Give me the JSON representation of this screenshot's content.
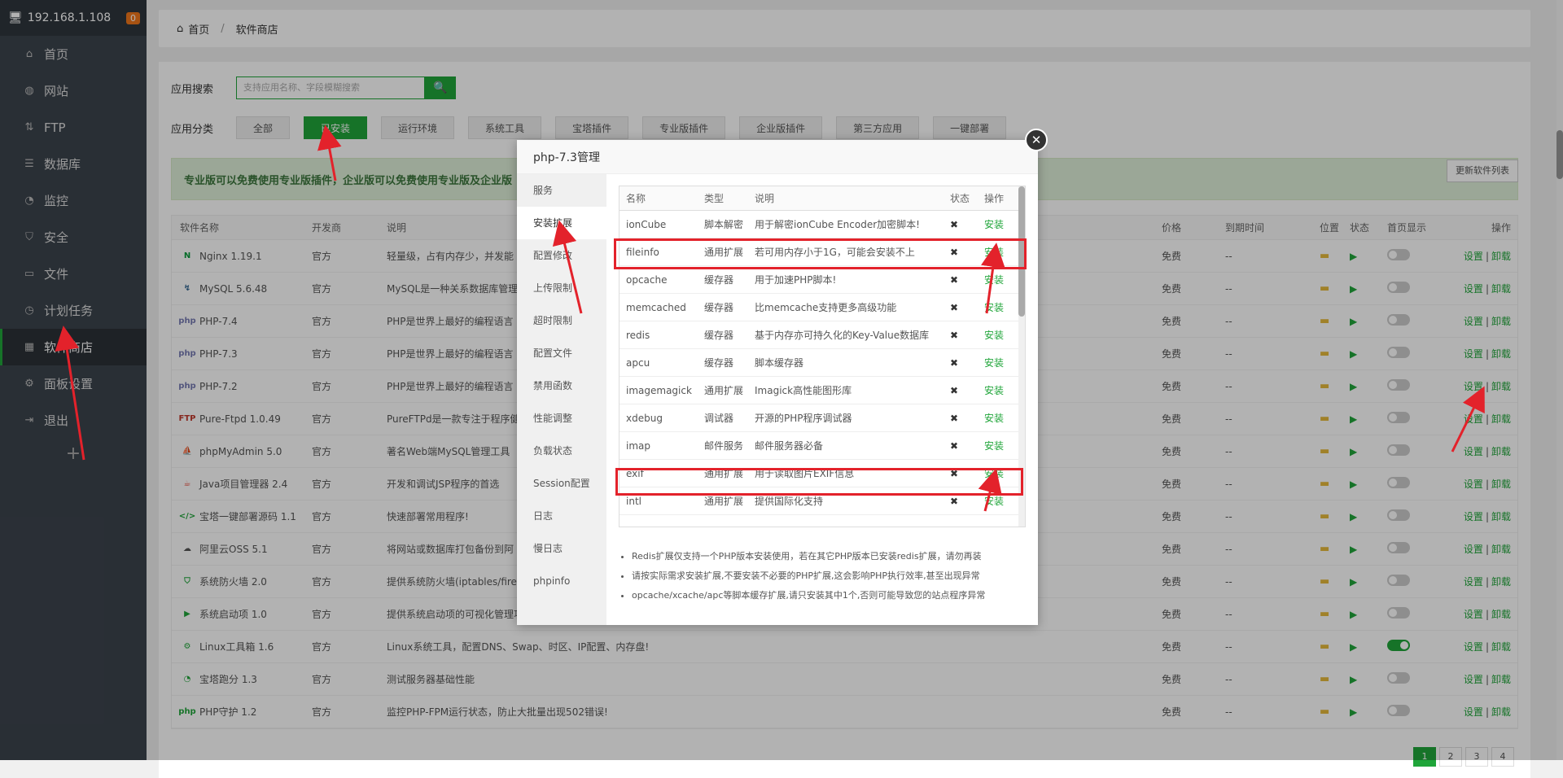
{
  "sidebar": {
    "host": "192.168.1.108",
    "badge": "0",
    "items": [
      {
        "label": "首页",
        "icon": "home-icon",
        "glyph": "⌂"
      },
      {
        "label": "网站",
        "icon": "globe-icon",
        "glyph": "◍"
      },
      {
        "label": "FTP",
        "icon": "ftp-icon",
        "glyph": "⇅"
      },
      {
        "label": "数据库",
        "icon": "database-icon",
        "glyph": "☰"
      },
      {
        "label": "监控",
        "icon": "monitor-icon",
        "glyph": "◔"
      },
      {
        "label": "安全",
        "icon": "shield-icon",
        "glyph": "⛉"
      },
      {
        "label": "文件",
        "icon": "file-icon",
        "glyph": "▭"
      },
      {
        "label": "计划任务",
        "icon": "clock-icon",
        "glyph": "◷"
      },
      {
        "label": "软件商店",
        "icon": "apps-icon",
        "glyph": "▦"
      },
      {
        "label": "面板设置",
        "icon": "gear-icon",
        "glyph": "⚙"
      },
      {
        "label": "退出",
        "icon": "logout-icon",
        "glyph": "⇥"
      }
    ],
    "active_index": 8,
    "add": "+"
  },
  "breadcrumb": {
    "home": "首页",
    "sep": "/",
    "current": "软件商店"
  },
  "search": {
    "label": "应用搜索",
    "placeholder": "支持应用名称、字段模糊搜索",
    "button": "🔍"
  },
  "categories": {
    "label": "应用分类",
    "items": [
      "全部",
      "已安装",
      "运行环境",
      "系统工具",
      "宝塔插件",
      "专业版插件",
      "企业版插件",
      "第三方应用",
      "一键部署"
    ],
    "active_index": 1,
    "refresh": "更新软件列表"
  },
  "notice": "专业版可以免费使用专业版插件，企业版可以免费使用专业版及企业版",
  "table": {
    "headers": {
      "name": "软件名称",
      "dev": "开发商",
      "desc": "说明",
      "price": "价格",
      "expire": "到期时间",
      "pos": "位置",
      "status": "状态",
      "home": "首页显示",
      "op": "操作"
    },
    "rows": [
      {
        "name": "Nginx 1.19.1",
        "icon": "N",
        "color": "#0a9b3c",
        "dev": "官方",
        "desc": "轻量级，占有内存少，并发能",
        "price": "免费",
        "expire": "--",
        "home_on": false
      },
      {
        "name": "MySQL 5.6.48",
        "icon": "↯",
        "color": "#336791",
        "dev": "官方",
        "desc": "MySQL是一种关系数据库管理",
        "price": "免费",
        "expire": "--",
        "home_on": false
      },
      {
        "name": "PHP-7.4",
        "icon": "php",
        "color": "#777bb3",
        "dev": "官方",
        "desc": "PHP是世界上最好的编程语言",
        "price": "免费",
        "expire": "--",
        "home_on": false
      },
      {
        "name": "PHP-7.3",
        "icon": "php",
        "color": "#777bb3",
        "dev": "官方",
        "desc": "PHP是世界上最好的编程语言",
        "price": "免费",
        "expire": "--",
        "home_on": false
      },
      {
        "name": "PHP-7.2",
        "icon": "php",
        "color": "#777bb3",
        "dev": "官方",
        "desc": "PHP是世界上最好的编程语言",
        "price": "免费",
        "expire": "--",
        "home_on": false
      },
      {
        "name": "Pure-Ftpd 1.0.49",
        "icon": "FTP",
        "color": "#c0392b",
        "dev": "官方",
        "desc": "PureFTPd是一款专注于程序健",
        "price": "免费",
        "expire": "--",
        "home_on": false
      },
      {
        "name": "phpMyAdmin 5.0",
        "icon": "⛵",
        "color": "#f39c12",
        "dev": "官方",
        "desc": "著名Web端MySQL管理工具",
        "price": "免费",
        "expire": "--",
        "home_on": false
      },
      {
        "name": "Java项目管理器 2.4",
        "icon": "☕",
        "color": "#e74c3c",
        "dev": "官方",
        "desc": "开发和调试JSP程序的首选",
        "price": "免费",
        "expire": "--",
        "home_on": false
      },
      {
        "name": "宝塔一键部署源码 1.1",
        "icon": "</>",
        "color": "#20a53a",
        "dev": "官方",
        "desc": "快速部署常用程序!",
        "price": "免费",
        "expire": "--",
        "home_on": false
      },
      {
        "name": "阿里云OSS 5.1",
        "icon": "☁",
        "color": "#555555",
        "dev": "官方",
        "desc": "将网站或数据库打包备份到阿",
        "price": "免费",
        "expire": "--",
        "home_on": false
      },
      {
        "name": "系统防火墙 2.0",
        "icon": "⛉",
        "color": "#20a53a",
        "dev": "官方",
        "desc": "提供系统防火墙(iptables/fire",
        "price": "免费",
        "expire": "--",
        "home_on": false
      },
      {
        "name": "系统启动项 1.0",
        "icon": "▶",
        "color": "#20a53a",
        "dev": "官方",
        "desc": "提供系统启动项的可视化管理功能",
        "price": "免费",
        "expire": "--",
        "home_on": false
      },
      {
        "name": "Linux工具箱 1.6",
        "icon": "⚙",
        "color": "#20a53a",
        "dev": "官方",
        "desc": "Linux系统工具，配置DNS、Swap、时区、IP配置、内存盘!",
        "price": "免费",
        "expire": "--",
        "home_on": true
      },
      {
        "name": "宝塔跑分 1.3",
        "icon": "◔",
        "color": "#20a53a",
        "dev": "官方",
        "desc": "测试服务器基础性能",
        "price": "免费",
        "expire": "--",
        "home_on": false
      },
      {
        "name": "PHP守护 1.2",
        "icon": "php",
        "color": "#20a53a",
        "dev": "官方",
        "desc": "监控PHP-FPM运行状态，防止大批量出现502错误!",
        "price": "免费",
        "expire": "--",
        "home_on": false
      }
    ],
    "op_set": "设置",
    "op_sep": "|",
    "op_uninstall": "卸载"
  },
  "modal": {
    "title": "php-7.3管理",
    "close": "✕",
    "menu": [
      "服务",
      "安装扩展",
      "配置修改",
      "上传限制",
      "超时限制",
      "配置文件",
      "禁用函数",
      "性能调整",
      "负载状态",
      "Session配置",
      "日志",
      "慢日志",
      "phpinfo"
    ],
    "menu_active": 1,
    "headers": {
      "name": "名称",
      "type": "类型",
      "desc": "说明",
      "status": "状态",
      "op": "操作"
    },
    "rows": [
      {
        "name": "ionCube",
        "type": "脚本解密",
        "desc": "用于解密ionCube Encoder加密脚本!"
      },
      {
        "name": "fileinfo",
        "type": "通用扩展",
        "desc": "若可用内存小于1G，可能会安装不上"
      },
      {
        "name": "opcache",
        "type": "缓存器",
        "desc": "用于加速PHP脚本!"
      },
      {
        "name": "memcached",
        "type": "缓存器",
        "desc": "比memcache支持更多高级功能"
      },
      {
        "name": "redis",
        "type": "缓存器",
        "desc": "基于内存亦可持久化的Key-Value数据库"
      },
      {
        "name": "apcu",
        "type": "缓存器",
        "desc": "脚本缓存器"
      },
      {
        "name": "imagemagick",
        "type": "通用扩展",
        "desc": "Imagick高性能图形库"
      },
      {
        "name": "xdebug",
        "type": "调试器",
        "desc": "开源的PHP程序调试器"
      },
      {
        "name": "imap",
        "type": "邮件服务",
        "desc": "邮件服务器必备"
      },
      {
        "name": "exif",
        "type": "通用扩展",
        "desc": "用于读取图片EXIF信息"
      },
      {
        "name": "intl",
        "type": "通用扩展",
        "desc": "提供国际化支持"
      }
    ],
    "status_mark": "✖",
    "install": "安装",
    "notes": [
      "Redis扩展仅支持一个PHP版本安装使用，若在其它PHP版本已安装redis扩展，请勿再装",
      "请按实际需求安装扩展,不要安装不必要的PHP扩展,这会影响PHP执行效率,甚至出现异常",
      "opcache/xcache/apc等脚本缓存扩展,请只安装其中1个,否则可能导致您的站点程序异常"
    ]
  },
  "pager": [
    "1",
    "2",
    "3",
    "4"
  ]
}
